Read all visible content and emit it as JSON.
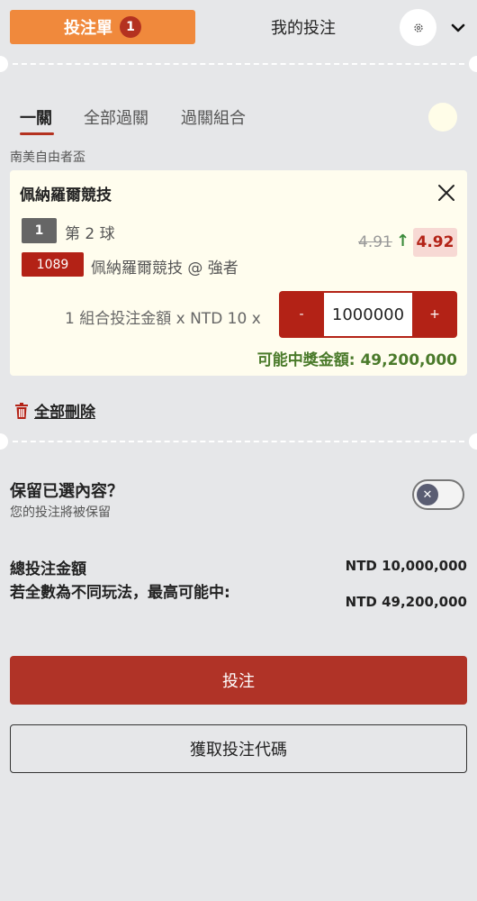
{
  "header": {
    "betslip_label": "投注單",
    "betslip_count": "1",
    "mybets_label": "我的投注"
  },
  "subtabs": [
    "一關",
    "全部過關",
    "過關組合"
  ],
  "competition": "南美自由者盃",
  "bet": {
    "match": "佩納羅爾競技",
    "market_tag": "1",
    "market": "第 2 球",
    "selection_tag": "1089",
    "selection": "佩納羅爾競技 @ 強者",
    "old_odds": "4.91",
    "arrow": "↑",
    "new_odds": "4.92",
    "stake_text": "1 組合投注金額 x NTD 10 x",
    "stake_value": "1000000",
    "minus": "-",
    "plus": "+",
    "potential": "可能中獎金額: 49,200,000"
  },
  "delete_all": "全部刪除",
  "keep": {
    "title": "保留已選內容？",
    "subtitle": "您的投注將被保留"
  },
  "totals": {
    "total_label": "總投注金額",
    "total_value": "NTD 10,000,000",
    "max_label": "若全數為不同玩法，最高可能中:",
    "max_value": "NTD 49,200,000"
  },
  "buttons": {
    "place_bet": "投注",
    "get_code": "獲取投注代碼"
  },
  "colors": {
    "accent_orange": "#f0893c",
    "brand_red": "#b32216",
    "win_green": "#4a7a2a"
  }
}
